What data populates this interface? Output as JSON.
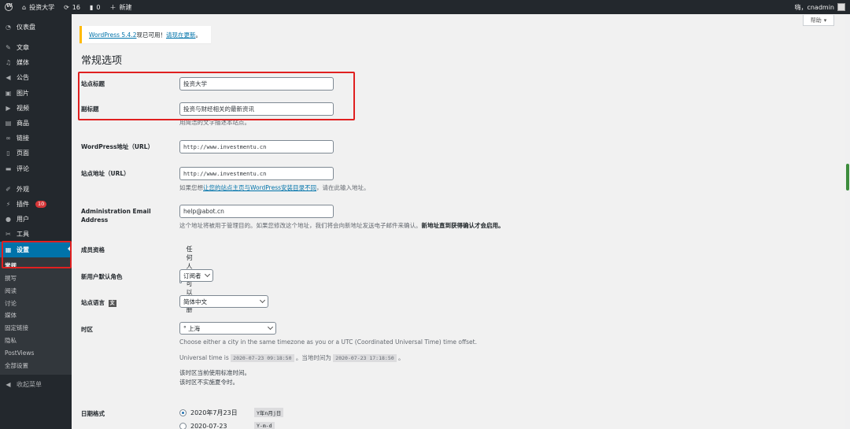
{
  "adminbar": {
    "site_name": "投资大学",
    "updates_count": "16",
    "comments_count": "0",
    "new_label": "新建",
    "greeting": "嗨，cnadmin"
  },
  "sidebar": {
    "items": [
      {
        "label": "仪表盘",
        "icon": "dashboard-icon"
      },
      {
        "label": "文章",
        "icon": "pin-icon"
      },
      {
        "label": "媒体",
        "icon": "media-icon"
      },
      {
        "label": "公告",
        "icon": "megaphone-icon"
      },
      {
        "label": "图片",
        "icon": "image-icon"
      },
      {
        "label": "视频",
        "icon": "video-icon"
      },
      {
        "label": "商品",
        "icon": "cart-icon"
      },
      {
        "label": "链接",
        "icon": "link-icon"
      },
      {
        "label": "页面",
        "icon": "page-icon"
      },
      {
        "label": "评论",
        "icon": "comment-icon"
      },
      {
        "label": "外观",
        "icon": "brush-icon"
      },
      {
        "label": "插件",
        "icon": "plugin-icon",
        "badge": "10"
      },
      {
        "label": "用户",
        "icon": "user-icon"
      },
      {
        "label": "工具",
        "icon": "wrench-icon"
      },
      {
        "label": "设置",
        "icon": "settings-icon"
      }
    ],
    "submenu": [
      "常规",
      "撰写",
      "阅读",
      "讨论",
      "媒体",
      "固定链接",
      "隐私",
      "PostViews",
      "全部设置"
    ],
    "collapse_label": "收起菜单"
  },
  "main": {
    "help_label": "帮助",
    "notice_link": "WordPress 5.4.2",
    "notice_text": "现已可用！",
    "notice_update": "请现在更新",
    "notice_end": "。",
    "title": "常规选项",
    "site_title_label": "站点标题",
    "site_title_value": "投资大学",
    "tagline_label": "副标题",
    "tagline_value": "投资与财经相关的最新资讯",
    "tagline_desc": "用简洁的文字描述本站点。",
    "wp_url_label": "WordPress地址（URL）",
    "wp_url_value": "http://www.investmentu.cn",
    "site_url_label": "站点地址（URL）",
    "site_url_value": "http://www.investmentu.cn",
    "site_url_desc_pre": "如果您想",
    "site_url_desc_link": "让您的站点主页与WordPress安装目录不同",
    "site_url_desc_post": "，请在此输入地址。",
    "admin_email_label": "Administration Email Address",
    "admin_email_value": "help@abot.cn",
    "admin_email_desc": "这个地址将被用于管理目的。如果您修改这个地址，我们将会向新地址发送电子邮件来确认。",
    "admin_email_desc_bold": "新地址直到获得确认才会启用。",
    "membership_label": "成员资格",
    "membership_option": "任何人都可以注册",
    "default_role_label": "新用户默认角色",
    "default_role_value": "订阅者",
    "language_label": "站点语言",
    "language_value": "简体中文",
    "timezone_label": "时区",
    "timezone_value": "上海",
    "timezone_desc": "Choose either a city in the same timezone as you or a UTC (Coordinated Universal Time) time offset.",
    "universal_time_label": "Universal time is",
    "universal_time_value": "2020-07-23 09:18:50",
    "local_time_label": "。当地时间为",
    "local_time_value": "2020-07-23 17:18:50",
    "local_time_end": "。",
    "dst_line1": "该时区当前使用标准时间。",
    "dst_line2": "该时区不实施夏令时。",
    "date_format_label": "日期格式",
    "date_option1": "2020年7月23日",
    "date_option1_code": "Y年n月j日",
    "date_option2": "2020-07-23",
    "date_option2_code": "Y-m-d"
  }
}
